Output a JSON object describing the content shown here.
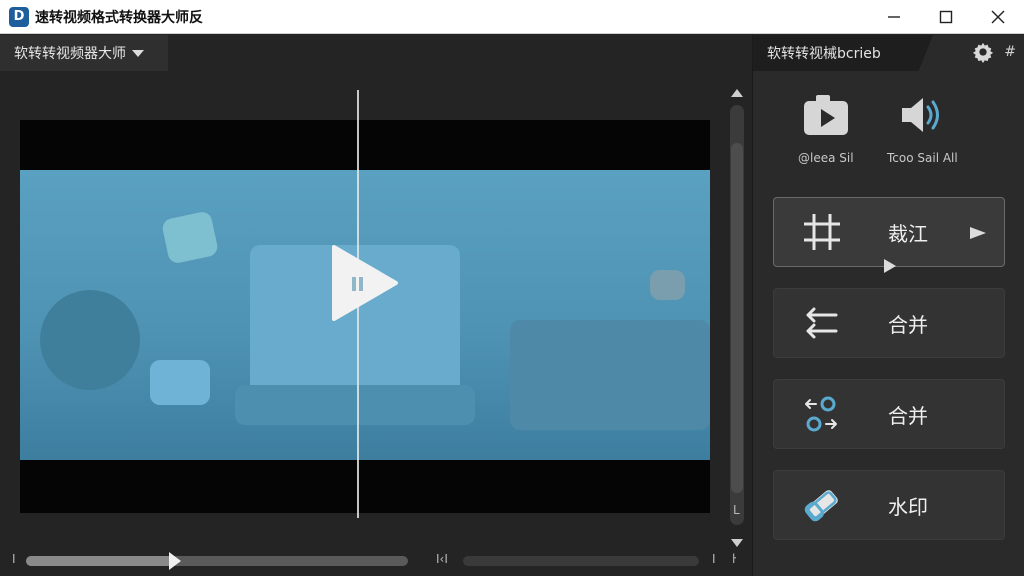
{
  "window": {
    "logo_letter": "D",
    "title": "速转视频格式转换器大师反"
  },
  "left": {
    "dropdown_label": "软转转视频器大师"
  },
  "player": {
    "progress": 0.39,
    "timeline_glyph_left": "I",
    "timeline_glyph_mid": "I‹I",
    "timeline_glyph_right": "I",
    "scroll_glyph": "L"
  },
  "right": {
    "tab_label": "软转转视械bcrieb",
    "quick_actions": [
      {
        "icon": "camera-play-icon",
        "label": "@leea Sil"
      },
      {
        "icon": "speaker-icon",
        "label": "Tcoo Sail All"
      }
    ],
    "tools": [
      {
        "icon": "crop-icon",
        "label": "裁江"
      },
      {
        "icon": "merge-arrows-icon",
        "label": "合并"
      },
      {
        "icon": "convert-icon",
        "label": "合并"
      },
      {
        "icon": "eraser-icon",
        "label": "水印"
      }
    ]
  },
  "colors": {
    "accent": "#5aa9cf",
    "video_blue": "#5aa0c0"
  }
}
